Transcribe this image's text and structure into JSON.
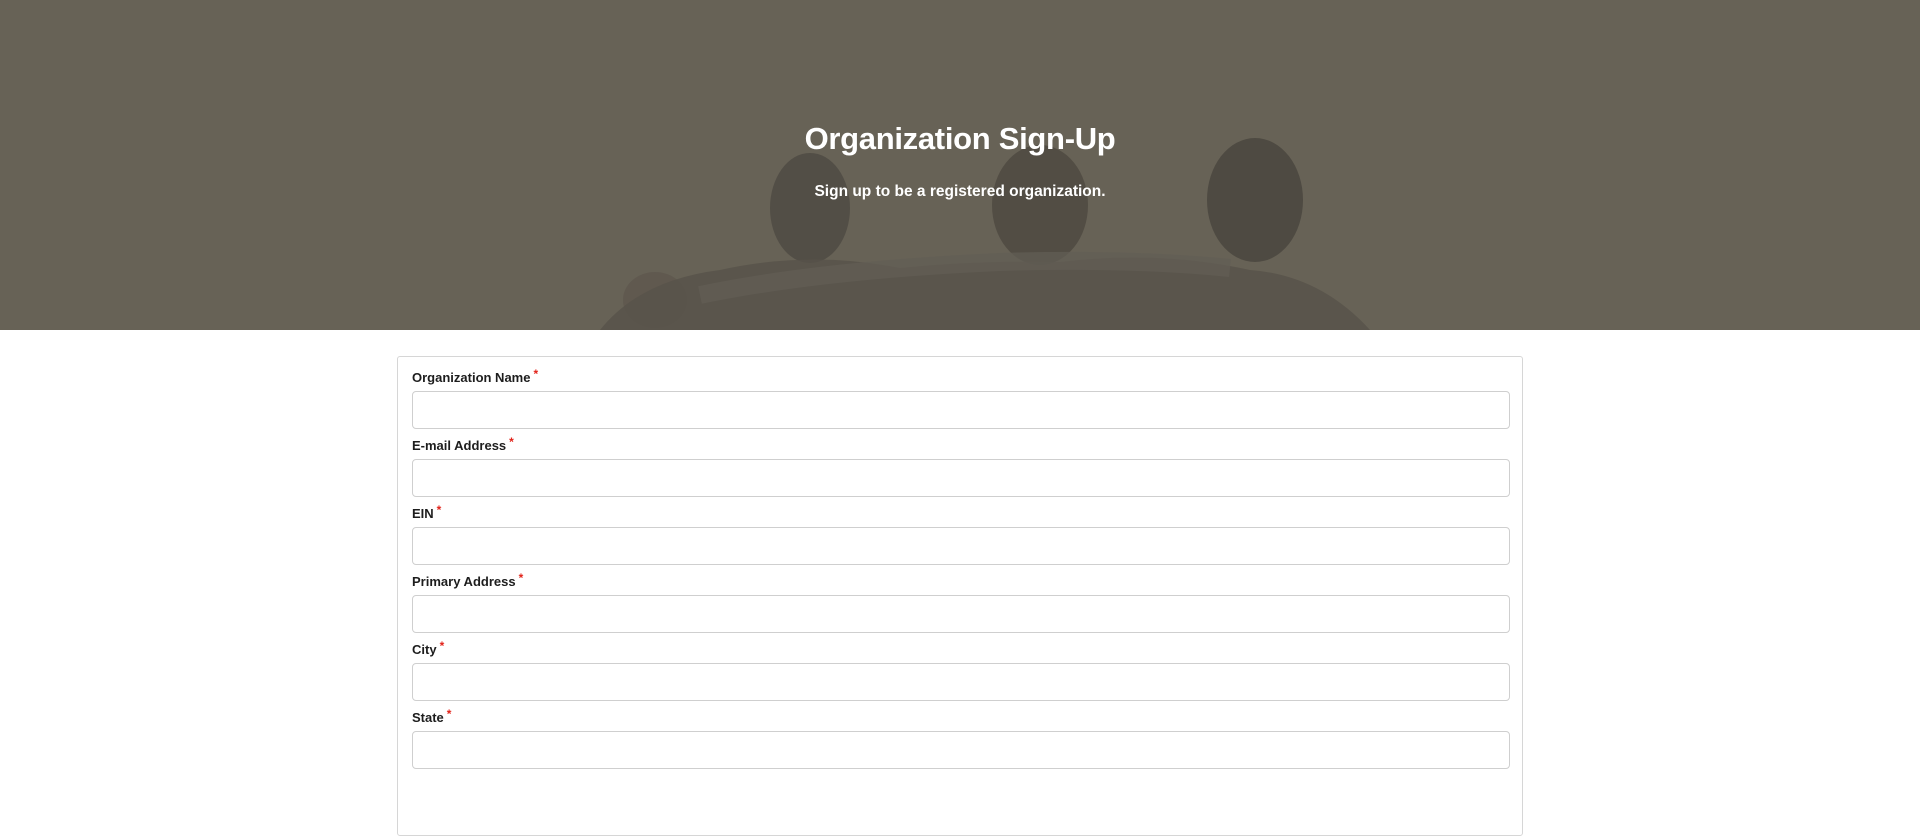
{
  "hero": {
    "title": "Organization Sign-Up",
    "subtitle": "Sign up to be a registered organization.",
    "background_color": "#696358"
  },
  "form": {
    "required_marker": "*",
    "required_color": "#e2231a",
    "fields": [
      {
        "label": "Organization Name",
        "value": "",
        "placeholder": "",
        "required": true
      },
      {
        "label": "E-mail Address",
        "value": "",
        "placeholder": "",
        "required": true
      },
      {
        "label": "EIN",
        "value": "",
        "placeholder": "",
        "required": true
      },
      {
        "label": "Primary Address",
        "value": "",
        "placeholder": "",
        "required": true
      },
      {
        "label": "City",
        "value": "",
        "placeholder": "",
        "required": true
      },
      {
        "label": "State",
        "value": "",
        "placeholder": "",
        "required": true
      }
    ]
  }
}
